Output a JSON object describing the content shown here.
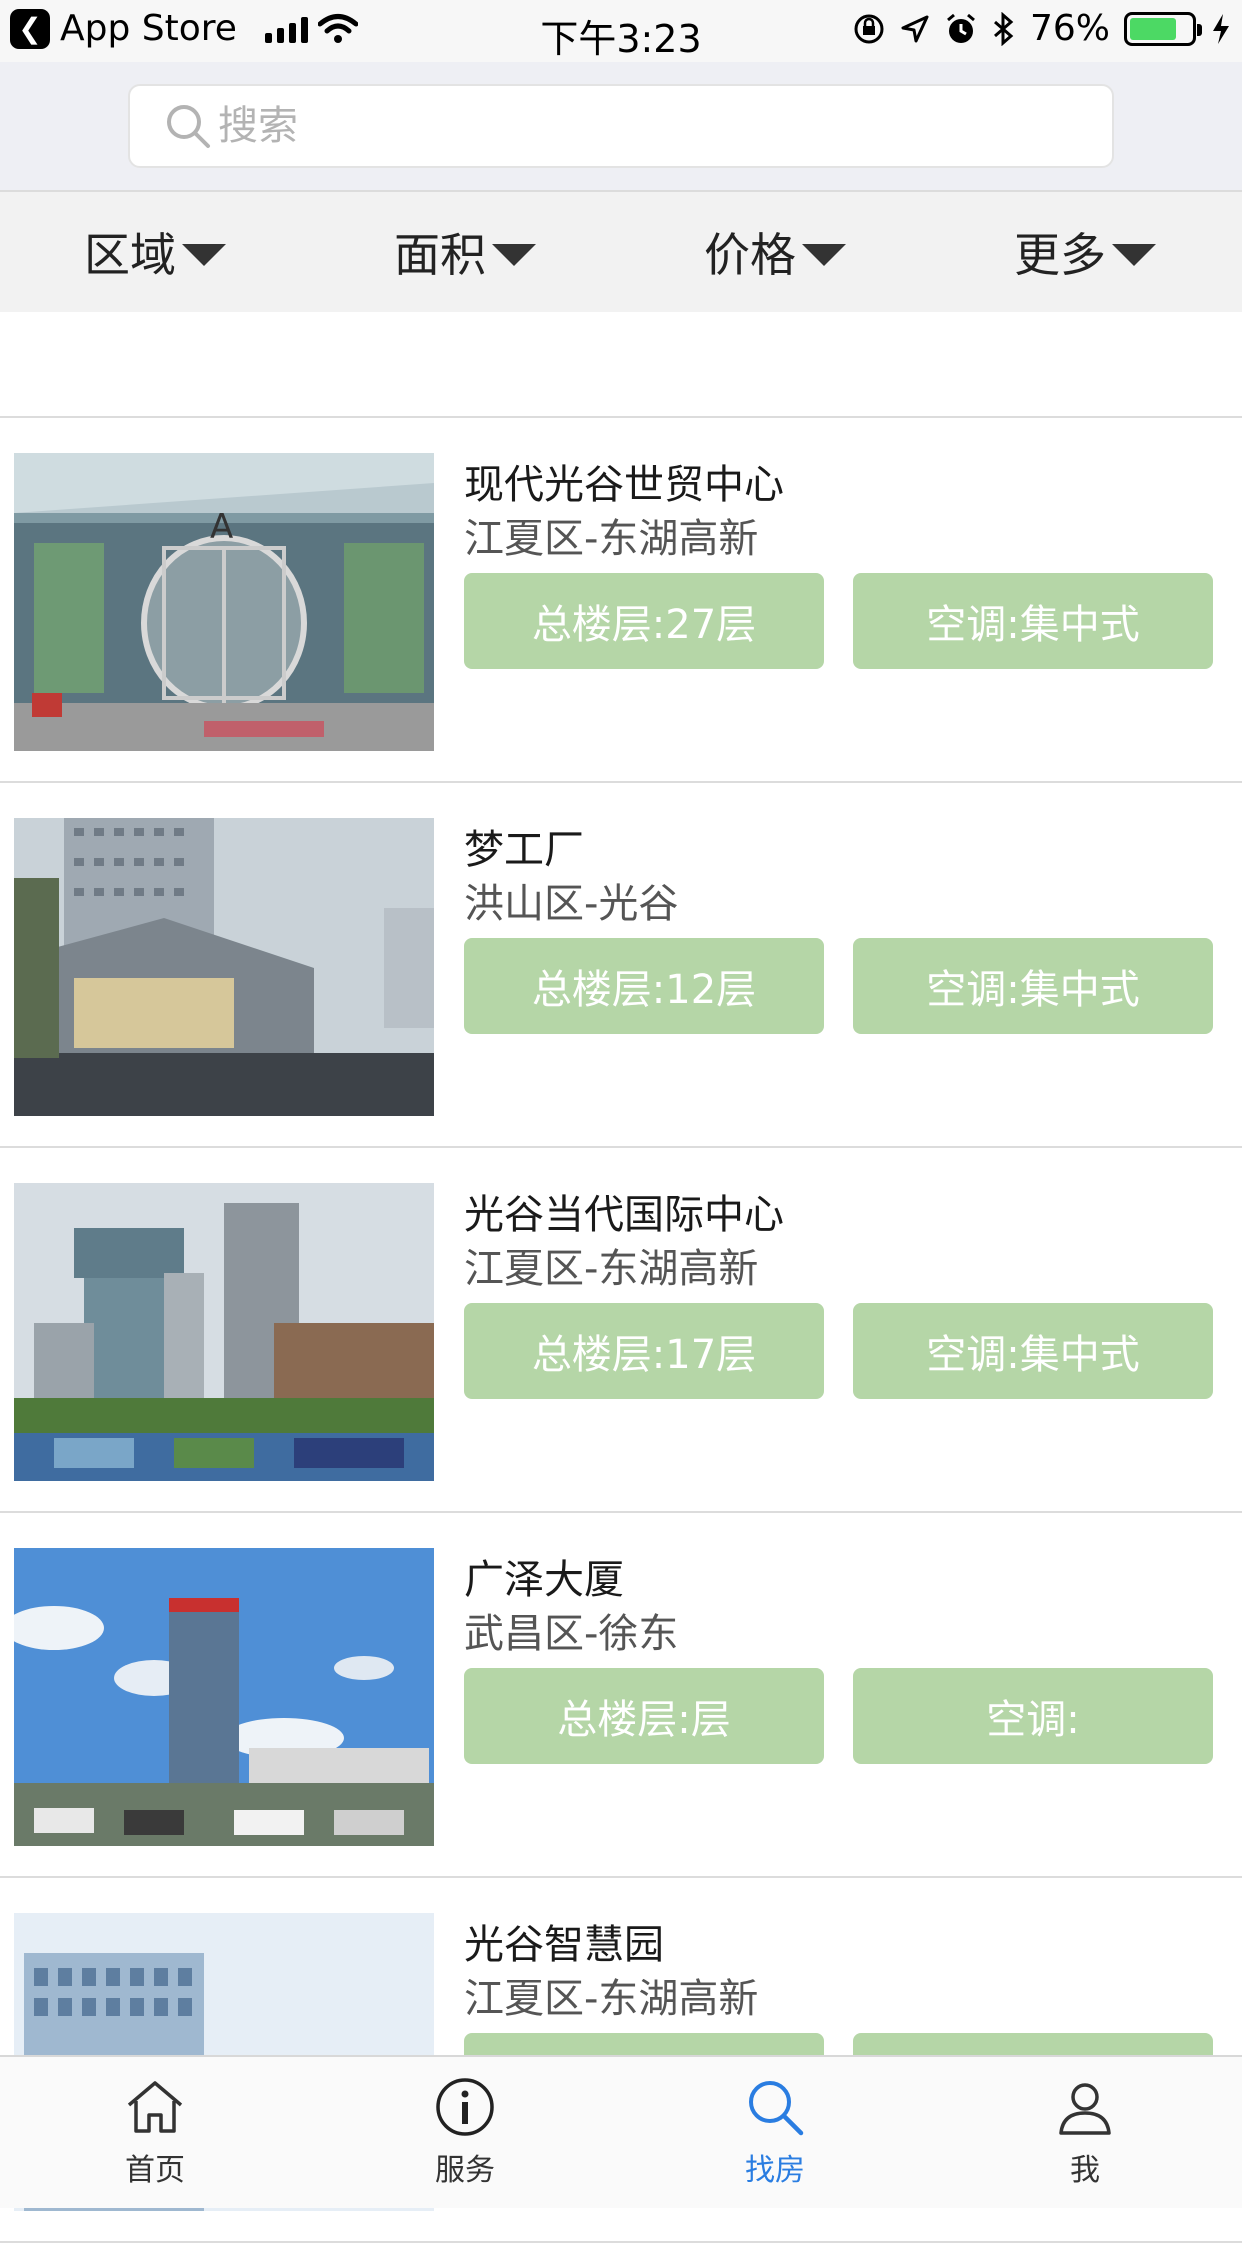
{
  "status_bar": {
    "back_app": "App Store",
    "time": "下午3:23",
    "battery_percent": "76%",
    "battery_level": 0.76
  },
  "search": {
    "placeholder": "搜索",
    "value": ""
  },
  "filters": [
    {
      "label": "区域"
    },
    {
      "label": "面积"
    },
    {
      "label": "价格"
    },
    {
      "label": "更多"
    }
  ],
  "listings": [
    {
      "title": "现代光谷世贸中心",
      "district": "江夏区-东湖高新",
      "floors": "总楼层:27层",
      "ac": "空调:集中式"
    },
    {
      "title": "梦工厂",
      "district": "洪山区-光谷",
      "floors": "总楼层:12层",
      "ac": "空调:集中式"
    },
    {
      "title": "光谷当代国际中心",
      "district": "江夏区-东湖高新",
      "floors": "总楼层:17层",
      "ac": "空调:集中式"
    },
    {
      "title": "广泽大厦",
      "district": "武昌区-徐东",
      "floors": "总楼层:层",
      "ac": "空调:"
    },
    {
      "title": "光谷智慧园",
      "district": "江夏区-东湖高新",
      "floors": "",
      "ac": ""
    }
  ],
  "tabs": [
    {
      "label": "首页",
      "icon": "home-icon"
    },
    {
      "label": "服务",
      "icon": "info-icon"
    },
    {
      "label": "找房",
      "icon": "search-icon",
      "active": true
    },
    {
      "label": "我",
      "icon": "user-icon"
    }
  ],
  "colors": {
    "tag_bg": "#b5d6a7",
    "active_tab": "#2a7de1",
    "battery": "#4cd964"
  }
}
